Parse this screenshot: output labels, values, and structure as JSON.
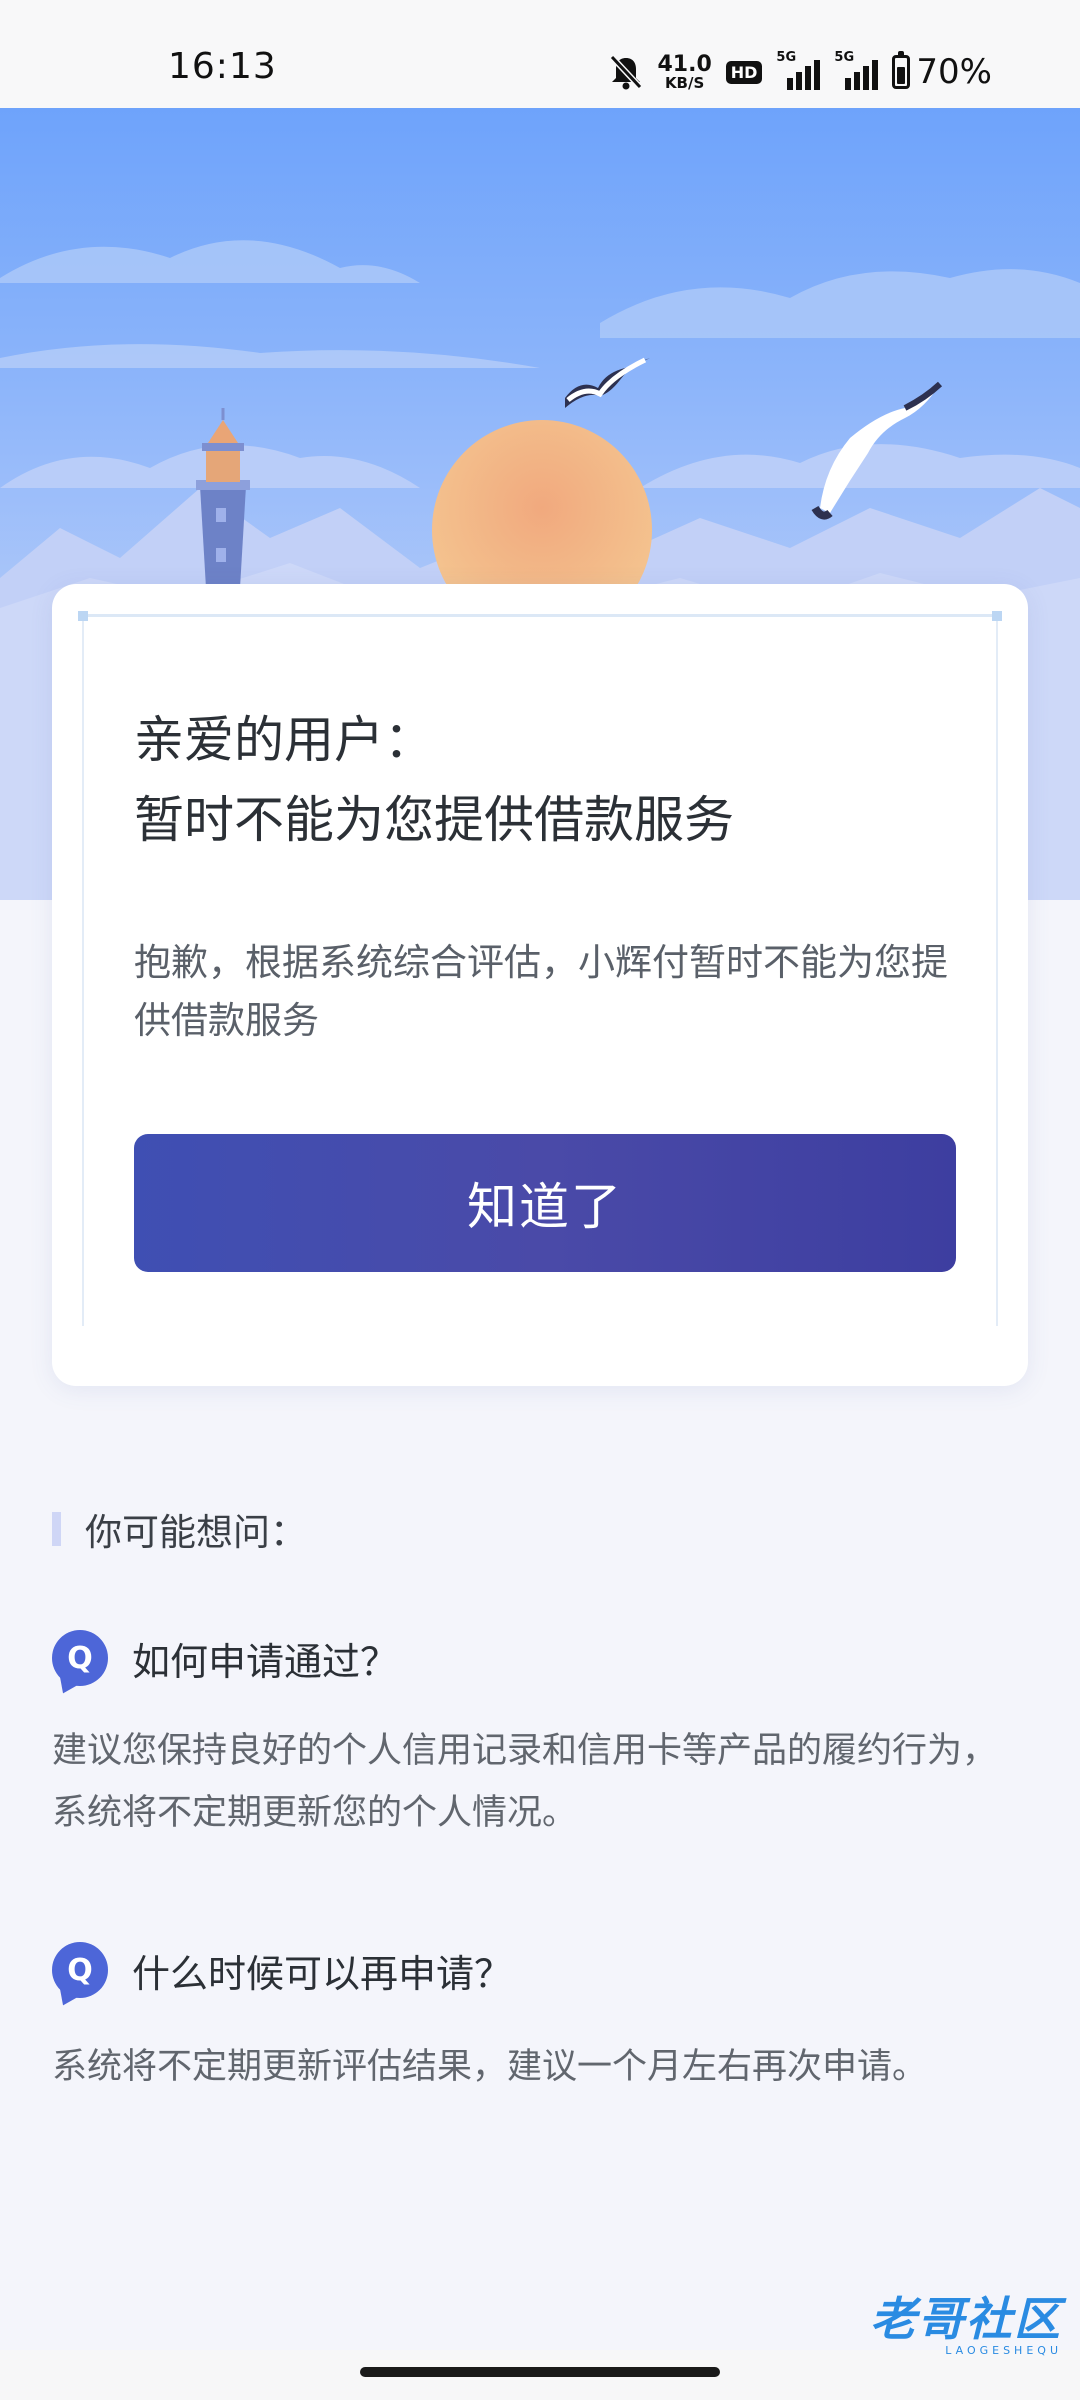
{
  "status_bar": {
    "time": "16:13",
    "net_speed_value": "41.0",
    "net_speed_unit": "KB/S",
    "hd_label": "HD",
    "sim1_tag": "5G",
    "sim2_tag": "5G",
    "battery_percent_text": "70%",
    "battery_level": 0.7,
    "icons": [
      "mute-bell-icon",
      "signal-icon",
      "battery-icon"
    ]
  },
  "card": {
    "title_line1": "亲爱的用户：",
    "title_line2": "暂时不能为您提供借款服务",
    "description": "抱歉，根据系统综合评估，小辉付暂时不能为您提供借款服务",
    "button_label": "知道了"
  },
  "faq": {
    "heading": "你可能想问：",
    "icon_letter": "Q",
    "items": [
      {
        "question": "如何申请通过？",
        "answer": "建议您保持良好的个人信用记录和信用卡等产品的履约行为，系统将不定期更新您的个人情况。"
      },
      {
        "question": "什么时候可以再申请？",
        "answer": "系统将不定期更新评估结果，建议一个月左右再次申请。"
      }
    ]
  },
  "watermark": {
    "main": "老哥社区",
    "sub": "LAOGESHEQU"
  },
  "colors": {
    "accent": "#4549aa",
    "question_icon": "#4d66d8",
    "sky_top": "#6ea3fb",
    "sun": "#f0b07e"
  }
}
